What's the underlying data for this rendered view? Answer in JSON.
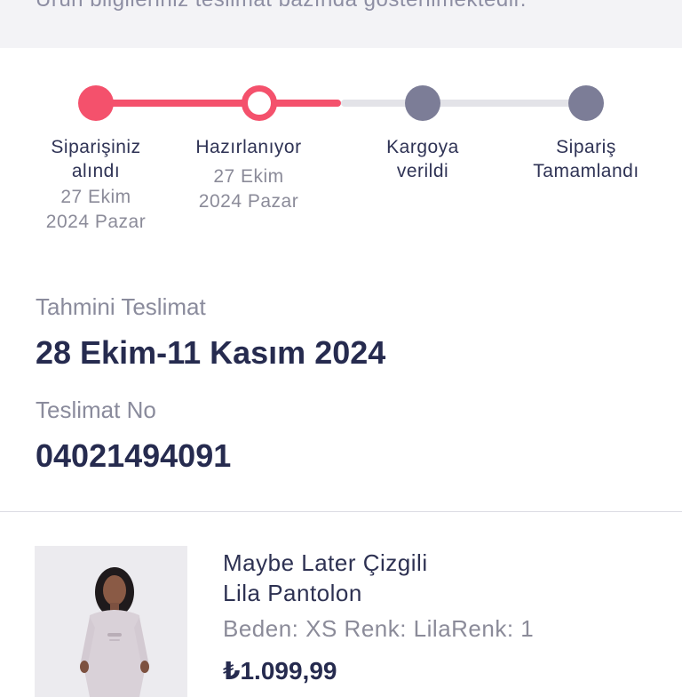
{
  "notice": {
    "text": "Ürün bilgileriniz teslimat bazında gösterilmektedir."
  },
  "tracker": {
    "steps": [
      {
        "label_line1": "Siparişiniz",
        "label_line2": "alındı",
        "date_line1": "27 Ekim",
        "date_line2": "2024 Pazar",
        "status": "done"
      },
      {
        "label_line1": "Hazırlanıyor",
        "label_line2": "",
        "date_line1": "27 Ekim",
        "date_line2": "2024 Pazar",
        "status": "current"
      },
      {
        "label_line1": "Kargoya",
        "label_line2": "verildi",
        "date_line1": "",
        "date_line2": "",
        "status": "pending"
      },
      {
        "label_line1": "Sipariş",
        "label_line2": "Tamamlandı",
        "date_line1": "",
        "date_line2": "",
        "status": "pending"
      }
    ],
    "colors": {
      "done": "#f4516c",
      "pending": "#7c7d97",
      "track_pending": "#e3e3e8"
    }
  },
  "delivery": {
    "estimate_label": "Tahmini Teslimat",
    "estimate_value": "28 Ekim-11 Kasım 2024",
    "number_label": "Teslimat No",
    "number_value": "04021494091"
  },
  "product": {
    "name_line1": "Maybe Later Çizgili",
    "name_line2": "Lila Pantolon",
    "attributes": "Beden: XS Renk: LilaRenk: 1",
    "price": "₺1.099,99"
  }
}
